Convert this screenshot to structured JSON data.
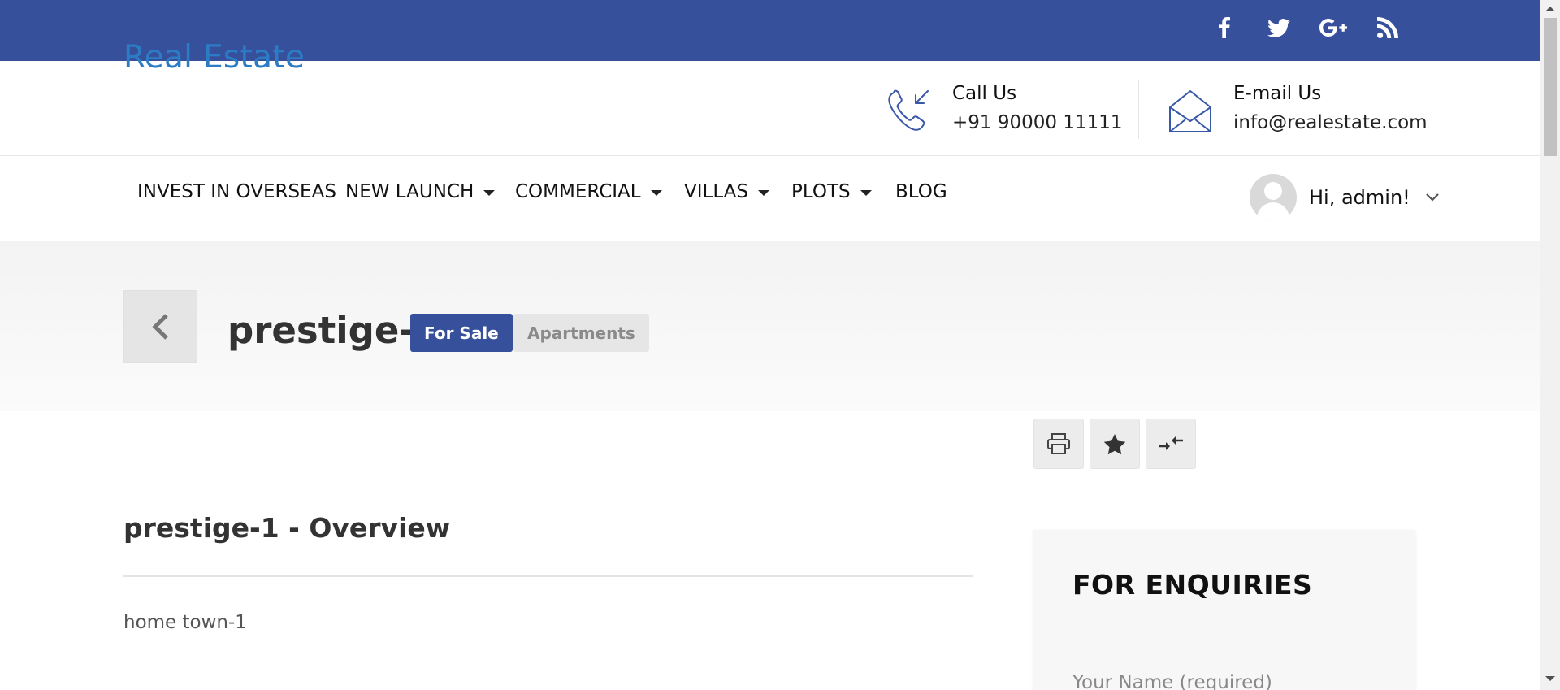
{
  "social": {
    "icons": [
      "facebook-icon",
      "twitter-icon",
      "google-plus-icon",
      "rss-icon"
    ]
  },
  "header": {
    "logo": "Real Estate",
    "call": {
      "label": "Call Us",
      "value": "+91 90000 11111"
    },
    "email": {
      "label": "E-mail Us",
      "value": "info@realestate.com"
    }
  },
  "nav": {
    "items": [
      {
        "label": "INVEST IN OVERSEAS"
      },
      {
        "label": "NEW LAUNCH"
      },
      {
        "label": "COMMERCIAL"
      },
      {
        "label": "VILLAS"
      },
      {
        "label": "PLOTS"
      },
      {
        "label": "BLOG"
      }
    ],
    "user_greeting": "Hi, admin!"
  },
  "property": {
    "title": "prestige-1",
    "status_badge": "For Sale",
    "type_badge": "Apartments"
  },
  "overview": {
    "title": "prestige-1 - Overview",
    "text": "home town-1"
  },
  "enquiry": {
    "title": "FOR ENQUIRIES",
    "name_placeholder": "Your Name (required)"
  },
  "colors": {
    "brand_blue": "#37509c",
    "logo_blue": "#2b7cc4"
  }
}
